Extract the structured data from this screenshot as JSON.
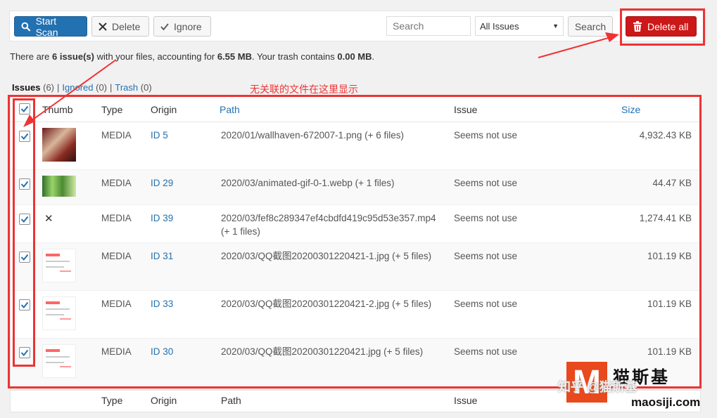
{
  "toolbar": {
    "start_scan": "Start Scan",
    "delete": "Delete",
    "ignore": "Ignore",
    "search_placeholder": "Search",
    "filter_selected": "All Issues",
    "search_button": "Search",
    "delete_all": "Delete all"
  },
  "summary": {
    "prefix": "There are ",
    "count": "6 issue(s)",
    "mid": " with your files, accounting for ",
    "size": "6.55 MB",
    "mid2": ". Your trash contains ",
    "trash": "0.00 MB",
    "suffix": "."
  },
  "views": {
    "issues": "Issues",
    "issues_count": "(6)",
    "ignored": "Ignored",
    "ignored_count": "(0)",
    "trash": "Trash",
    "trash_count": "(0)"
  },
  "annotation": "无关联的文件在这里显示",
  "columns": {
    "thumb": "Thumb",
    "type": "Type",
    "origin": "Origin",
    "path": "Path",
    "issue": "Issue",
    "size": "Size"
  },
  "rows": [
    {
      "type": "MEDIA",
      "origin": "ID 5",
      "path": "2020/01/wallhaven-672007-1.png (+ 6 files)",
      "issue": "Seems not use",
      "size": "4,932.43 KB",
      "thumb": "image"
    },
    {
      "type": "MEDIA",
      "origin": "ID 29",
      "path": "2020/03/animated-gif-0-1.webp (+ 1 files)",
      "issue": "Seems not use",
      "size": "44.47 KB",
      "thumb": "image"
    },
    {
      "type": "MEDIA",
      "origin": "ID 39",
      "path": "2020/03/fef8c289347ef4cbdfd419c95d53e357.mp4 (+ 1 files)",
      "issue": "Seems not use",
      "size": "1,274.41 KB",
      "thumb": "none"
    },
    {
      "type": "MEDIA",
      "origin": "ID 31",
      "path": "2020/03/QQ截图20200301220421-1.jpg (+ 5 files)",
      "issue": "Seems not use",
      "size": "101.19 KB",
      "thumb": "screenshot"
    },
    {
      "type": "MEDIA",
      "origin": "ID 33",
      "path": "2020/03/QQ截图20200301220421-2.jpg (+ 5 files)",
      "issue": "Seems not use",
      "size": "101.19 KB",
      "thumb": "screenshot"
    },
    {
      "type": "MEDIA",
      "origin": "ID 30",
      "path": "2020/03/QQ截图20200301220421.jpg (+ 5 files)",
      "issue": "Seems not use",
      "size": "101.19 KB",
      "thumb": "screenshot"
    }
  ],
  "watermark": {
    "line1": "知乎 @猫斯基",
    "line2": "maosiji.com",
    "logo_letter": "M",
    "logo_text": "猫斯基"
  },
  "colors": {
    "primary": "#2271b1",
    "danger": "#cc1818",
    "annotation": "#ee3333"
  }
}
